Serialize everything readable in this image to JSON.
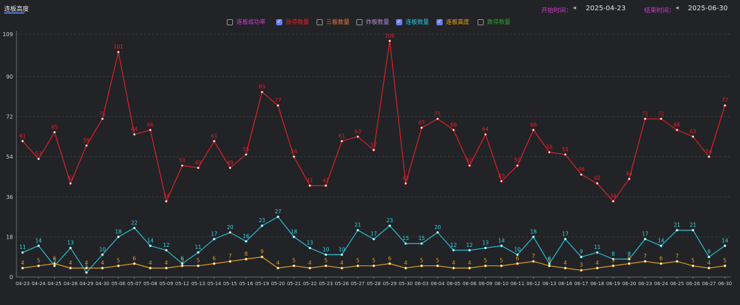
{
  "tab": {
    "label": "连板高度"
  },
  "date_range": {
    "start_label": "开始时间：",
    "start_value": "2025-04-23",
    "end_label": "结束时间：",
    "end_value": "2025-06-30",
    "prev_symbol": "◂"
  },
  "legend": [
    {
      "label": "连板成功率",
      "color": "#d23bd2",
      "checked": false
    },
    {
      "label": "涨停数量",
      "color": "#e0232a",
      "checked": true
    },
    {
      "label": "三板数量",
      "color": "#e07a3c",
      "checked": false
    },
    {
      "label": "炸板数量",
      "color": "#b38ad8",
      "checked": false
    },
    {
      "label": "连板数量",
      "color": "#26c6da",
      "checked": true
    },
    {
      "label": "连板高度",
      "color": "#e8a21d",
      "checked": true
    },
    {
      "label": "跌停数量",
      "color": "#2aa52a",
      "checked": false
    }
  ],
  "check_symbol": "✓",
  "chart_data": {
    "type": "line",
    "ylim": [
      0,
      109
    ],
    "yticks": [
      0,
      18,
      36,
      54,
      72,
      90,
      109
    ],
    "categories": [
      "04-23",
      "04-24",
      "04-25",
      "04-28",
      "04-29",
      "04-30",
      "05-06",
      "05-07",
      "05-08",
      "05-09",
      "05-12",
      "05-13",
      "05-14",
      "05-15",
      "05-16",
      "05-19",
      "05-20",
      "05-21",
      "05-22",
      "05-23",
      "05-26",
      "05-27",
      "05-28",
      "05-29",
      "05-30",
      "06-03",
      "06-04",
      "06-05",
      "06-06",
      "06-09",
      "06-10",
      "06-11",
      "06-12",
      "06-13",
      "06-16",
      "06-17",
      "06-18",
      "06-19",
      "06-20",
      "06-23",
      "06-24",
      "06-25",
      "06-26",
      "06-27",
      "06-30"
    ],
    "series": [
      {
        "name": "涨停数量",
        "color": "#e0232a",
        "label_color": "#e0232a",
        "values": [
          61,
          53,
          65,
          42,
          59,
          71,
          101,
          64,
          66,
          34,
          50,
          49,
          61,
          49,
          55,
          83,
          77,
          54,
          41,
          41,
          61,
          63,
          57,
          106,
          42,
          67,
          71,
          66,
          50,
          64,
          43,
          50,
          66,
          56,
          55,
          46,
          42,
          34,
          44,
          71,
          71,
          66,
          63,
          54,
          77
        ]
      },
      {
        "name": "连板数量",
        "color": "#26c6da",
        "label_color": "#3ad6e4",
        "values": [
          11,
          14,
          5,
          13,
          2,
          10,
          18,
          22,
          14,
          12,
          6,
          11,
          17,
          20,
          16,
          23,
          27,
          18,
          13,
          10,
          10,
          21,
          17,
          23,
          15,
          15,
          20,
          12,
          12,
          13,
          14,
          10,
          18,
          6,
          17,
          9,
          11,
          8,
          8,
          17,
          14,
          21,
          21,
          9,
          14
        ]
      },
      {
        "name": "连板高度",
        "color": "#e8a21d",
        "label_color": "#e8a21d",
        "values": [
          4,
          5,
          6,
          4,
          4,
          4,
          5,
          6,
          4,
          4,
          5,
          5,
          6,
          7,
          8,
          9,
          4,
          5,
          4,
          5,
          4,
          5,
          5,
          6,
          4,
          5,
          5,
          4,
          4,
          5,
          5,
          6,
          7,
          5,
          4,
          3,
          4,
          5,
          6,
          7,
          6,
          7,
          5,
          4,
          5
        ]
      }
    ]
  }
}
